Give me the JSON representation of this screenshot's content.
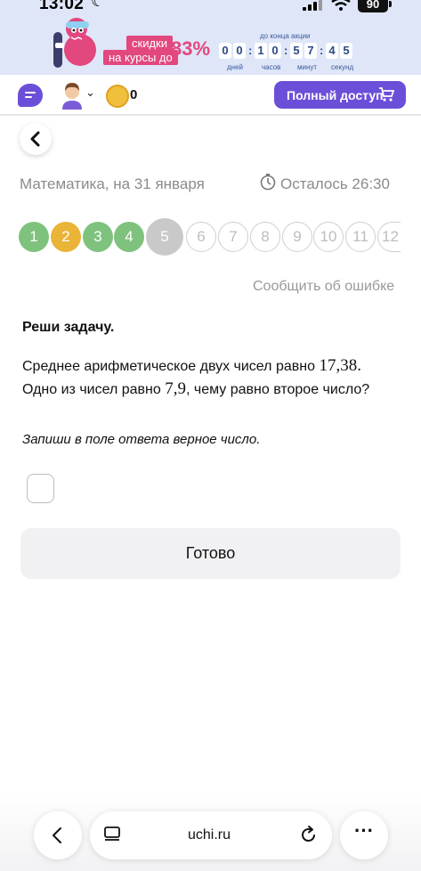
{
  "status_bar": {
    "time": "13:02",
    "battery": "90"
  },
  "promo": {
    "tag_line1": "скидки",
    "tag_line2": "на курсы до",
    "percent": "83%",
    "until_label": "до конца акции",
    "digits": [
      "0",
      "0",
      "1",
      "0",
      "5",
      "7",
      "4",
      "5"
    ],
    "units": [
      "дней",
      "часов",
      "минут",
      "секунд"
    ]
  },
  "header": {
    "coins": "0",
    "full_access_label": "Полный доступ",
    "accent_color": "#6b4fd8"
  },
  "lesson": {
    "subject": "Математика, на 31 января",
    "timer": "Осталось 26:30"
  },
  "questions": [
    {
      "label": "1",
      "state": "correct"
    },
    {
      "label": "2",
      "state": "partial"
    },
    {
      "label": "3",
      "state": "correct"
    },
    {
      "label": "4",
      "state": "correct"
    },
    {
      "label": "5",
      "state": "current"
    },
    {
      "label": "6",
      "state": "todo"
    },
    {
      "label": "7",
      "state": "todo"
    },
    {
      "label": "8",
      "state": "todo"
    },
    {
      "label": "9",
      "state": "todo"
    },
    {
      "label": "10",
      "state": "todo"
    },
    {
      "label": "11",
      "state": "todo"
    },
    {
      "label": "12",
      "state": "todo"
    }
  ],
  "report_label": "Сообщить об ошибке",
  "task": {
    "title": "Реши задачу.",
    "line1_text": "Среднее арифметическое двух чисел равно ",
    "line1_num": "17,38",
    "line1_end": ".",
    "line2_text_a": "Одно из чисел равно ",
    "line2_num": "7,9",
    "line2_text_b": ", чему равно второе число?",
    "hint": "Запиши в поле ответа верное число.",
    "answer_value": ""
  },
  "done_label": "Готово",
  "browser": {
    "url": "uchi.ru"
  }
}
